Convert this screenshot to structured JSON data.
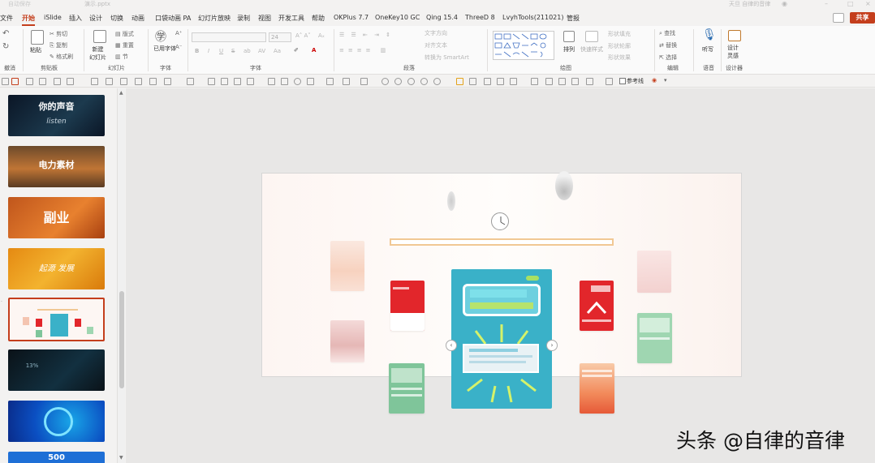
{
  "titlebar": {
    "app_label": "自动保存",
    "doc_name": "演示.pptx",
    "user": "天旦 自律的音律"
  },
  "tabs": [
    "文件",
    "开始",
    "iSlide",
    "插入",
    "设计",
    "切换",
    "动画",
    "口袋动画 PA",
    "幻灯片放映",
    "录制",
    "视图",
    "开发工具",
    "帮助",
    "OKPlus 7.7",
    "OneKey10 GC",
    "Qing 15.4",
    "ThreeD 8",
    "LvyhTools(211021)",
    "管报"
  ],
  "active_tab": "开始",
  "share_label": "共享",
  "ribbon": {
    "groups": [
      "撤消",
      "剪贴板",
      "幻灯片",
      "字体",
      "段落",
      "绘图",
      "编辑",
      "语音",
      "设计器"
    ],
    "undo": {
      "label": "撤消"
    },
    "clipboard": {
      "paste": "粘贴",
      "cut": "剪切",
      "copy": "复制",
      "format_painter": "格式刷"
    },
    "slides": {
      "new_slide": "新建\n幻灯片",
      "layout": "版式",
      "reset": "重置",
      "section": "节"
    },
    "font": {
      "used_fonts": "已用字体",
      "size": "24"
    },
    "paragraph": {
      "text_direction": "文字方向",
      "align_text": "对齐文本",
      "smartart": "转换为 SmartArt"
    },
    "drawing": {
      "arrange": "排列",
      "quick_styles": "快速样式",
      "fill": "形状填充",
      "outline": "形状轮廓",
      "effects": "形状效果"
    },
    "editing": {
      "find": "查找",
      "replace": "替换",
      "select": "选择"
    },
    "voice": {
      "dictate": "听写"
    },
    "designer": {
      "ideas": "设计\n灵感"
    }
  },
  "qat": {
    "reference_line": "参考线"
  },
  "thumbnails": [
    {
      "title": "你的声音",
      "sub": "listen"
    },
    {
      "title": "电力素材",
      "sub": ""
    },
    {
      "title": "副业",
      "sub": ""
    },
    {
      "title": "起源 发展",
      "sub": ""
    },
    {
      "title": "",
      "sub": ""
    },
    {
      "title": "",
      "sub": "13%"
    },
    {
      "title": "",
      "sub": ""
    },
    {
      "title": "500",
      "sub": ""
    }
  ],
  "watermark": "头条 @自律的音律",
  "colors": {
    "accent": "#c43e1c",
    "teal": "#3ab1c8",
    "red": "#e2262b",
    "green": "#7fc59a"
  }
}
